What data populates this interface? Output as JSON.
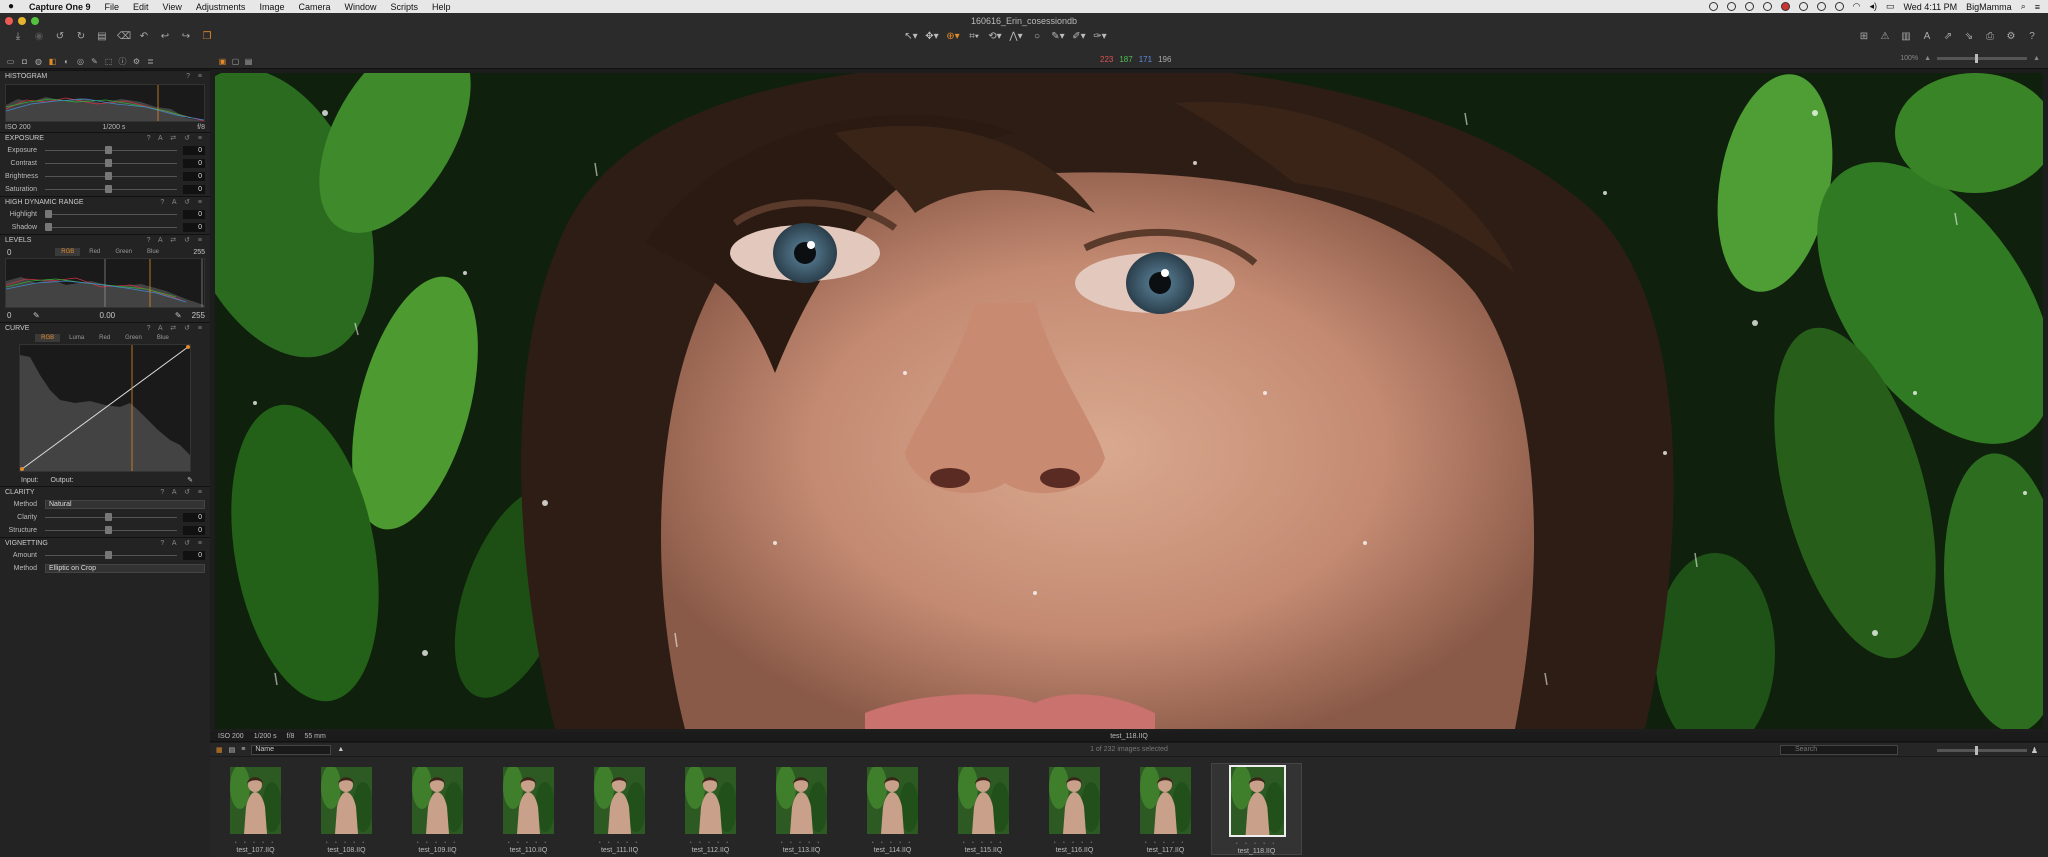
{
  "menubar": {
    "apple": "",
    "items": [
      "Capture One 9",
      "File",
      "Edit",
      "View",
      "Adjustments",
      "Image",
      "Camera",
      "Window",
      "Scripts",
      "Help"
    ],
    "clock": "Wed 4:11 PM",
    "user": "BigMamma"
  },
  "window": {
    "title": "160616_Erin_cosessiondb"
  },
  "readout": {
    "r": "223",
    "g": "187",
    "b": "171",
    "l": "196"
  },
  "zoom": {
    "label": "100%"
  },
  "histogram": {
    "title": "HISTOGRAM",
    "iso": "ISO 200",
    "shutter": "1/200 s",
    "aperture": "f/8"
  },
  "exposure": {
    "title": "EXPOSURE",
    "rows": [
      {
        "label": "Exposure",
        "value": "0"
      },
      {
        "label": "Contrast",
        "value": "0"
      },
      {
        "label": "Brightness",
        "value": "0"
      },
      {
        "label": "Saturation",
        "value": "0"
      }
    ]
  },
  "hdr": {
    "title": "HIGH DYNAMIC RANGE",
    "rows": [
      {
        "label": "Highlight",
        "value": "0"
      },
      {
        "label": "Shadow",
        "value": "0"
      }
    ]
  },
  "levels": {
    "title": "LEVELS",
    "low": "0",
    "high": "255",
    "tabs": [
      "RGB",
      "Red",
      "Green",
      "Blue"
    ],
    "out_low": "0",
    "mid": "0.00",
    "out_high": "255"
  },
  "curve": {
    "title": "CURVE",
    "tabs": [
      "RGB",
      "Luma",
      "Red",
      "Green",
      "Blue"
    ],
    "input": "Input:",
    "output": "Output:"
  },
  "clarity": {
    "title": "CLARITY",
    "method_label": "Method",
    "method_value": "Natural",
    "rows": [
      {
        "label": "Clarity",
        "value": "0"
      },
      {
        "label": "Structure",
        "value": "0"
      }
    ]
  },
  "vignetting": {
    "title": "VIGNETTING",
    "amount_label": "Amount",
    "amount_value": "0",
    "method_label": "Method",
    "method_value": "Elliptic on Crop"
  },
  "viewer_footer": {
    "iso": "ISO 200",
    "shutter": "1/200 s",
    "aperture": "f/8",
    "focal": "55 mm",
    "filename": "test_118.IIQ"
  },
  "browser": {
    "sort": "Name",
    "count": "1 of 232 images selected",
    "search_placeholder": "Search",
    "thumbs": [
      "test_107.IIQ",
      "test_108.IIQ",
      "test_109.IIQ",
      "test_110.IIQ",
      "test_111.IIQ",
      "test_112.IIQ",
      "test_113.IIQ",
      "test_114.IIQ",
      "test_115.IIQ",
      "test_116.IIQ",
      "test_117.IIQ",
      "test_118.IIQ"
    ],
    "selected": "test_118.IIQ"
  },
  "colors": {
    "accent": "#e08a2a",
    "panel": "#232323",
    "background": "#1b1b1b"
  }
}
